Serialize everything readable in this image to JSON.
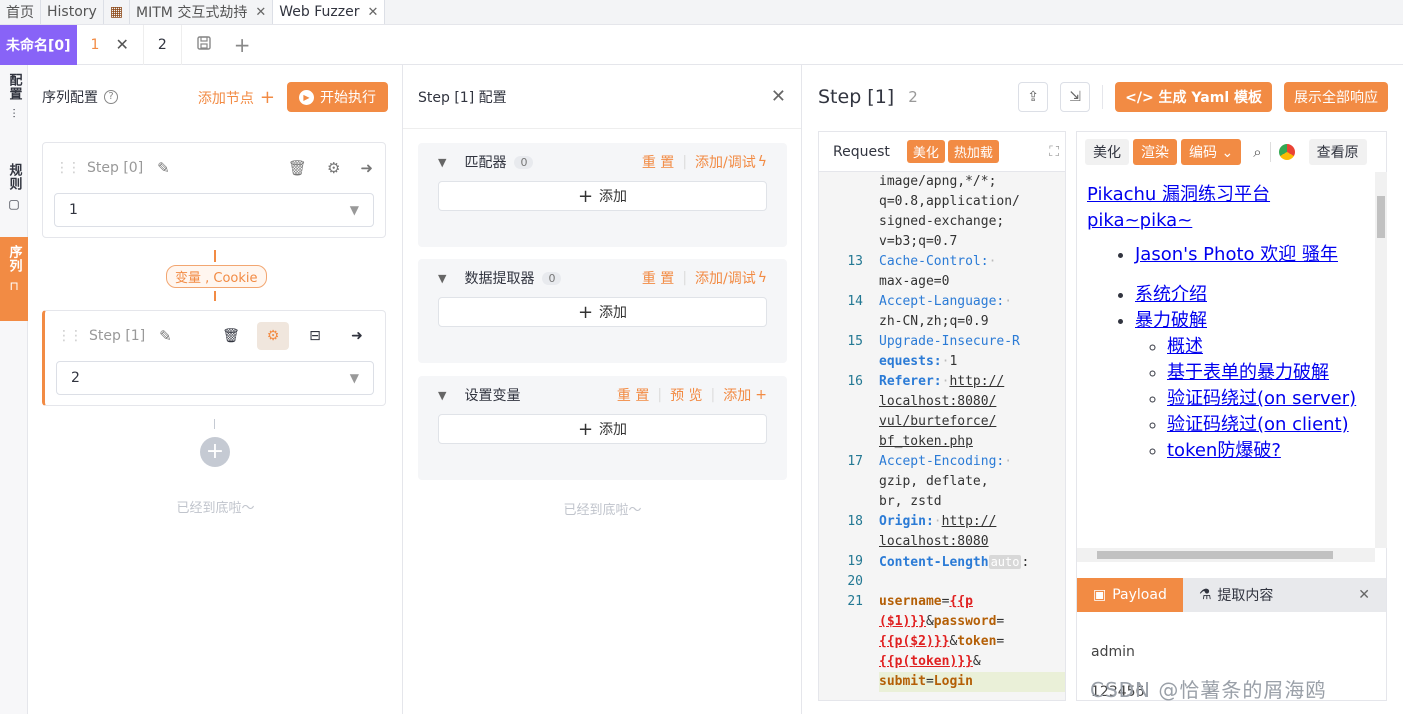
{
  "top_tabs": [
    {
      "label": "首页"
    },
    {
      "label": "History"
    },
    {
      "label": "MITM 交互式劫持",
      "close": "✕"
    },
    {
      "label": "Web Fuzzer",
      "close": "✕"
    }
  ],
  "sub_tabs": {
    "group": "未命名[0]",
    "tab1": "1",
    "tab1_close": "✕",
    "tab2": "2",
    "save_icon": "save-icon",
    "add_icon": "+"
  },
  "vertical_bar": {
    "config": "配置",
    "rules": "规则",
    "sequence": "序列"
  },
  "sequence": {
    "title": "序列配置",
    "help": "?",
    "add_node": "添加节点",
    "run": "开始执行",
    "steps": [
      {
        "name": "Step [0]",
        "value": "1"
      },
      {
        "name": "Step [1]",
        "value": "2"
      }
    ],
    "var_tag": "变量 , Cookie",
    "add_step": "+",
    "bottom_tip": "已经到底啦～"
  },
  "step_config": {
    "title": "Step [1] 配置",
    "close": "✕",
    "sections": [
      {
        "name": "匹配器",
        "count": "0",
        "act1": "重 置",
        "act2": "添加/调试",
        "add": "添加"
      },
      {
        "name": "数据提取器",
        "count": "0",
        "act1": "重 置",
        "act2": "添加/调试",
        "add": "添加"
      },
      {
        "name": "设置变量",
        "act1": "重 置",
        "act2": "预 览",
        "act3": "添加",
        "add": "添加"
      }
    ],
    "bottom_tip": "已经到底啦～"
  },
  "response": {
    "title": "Step [1]",
    "num": "2",
    "yaml_btn": "</> 生成 Yaml 模板",
    "show_all_btn": "展示全部响应",
    "request_label": "Request",
    "beautify": "美化",
    "hot_reload": "热加载",
    "code_lines": [
      {
        "n": "",
        "t": "image/apng,*/*;"
      },
      {
        "n": "",
        "t": "q=0.8,application/"
      },
      {
        "n": "",
        "t": "signed-exchange;"
      },
      {
        "n": "",
        "t": "v=b3;q=0.7"
      },
      {
        "n": "13",
        "k": "Cache-Control:",
        "t": "max-age=0"
      },
      {
        "n": "14",
        "k": "Accept-Language:",
        "t": "zh-CN,zh;q=0.9"
      },
      {
        "n": "15",
        "k": "Upgrade-Insecure-R",
        "k2": "equests:",
        "t": "1"
      },
      {
        "n": "16",
        "k": "Referer:",
        "u1": "http://",
        "u2": "localhost:8080/",
        "u3": "vul/burteforce/",
        "u4": "bf_token.php"
      },
      {
        "n": "17",
        "k": "Accept-Encoding:",
        "t1": "gzip, deflate,",
        "t2": "br, zstd"
      },
      {
        "n": "18",
        "k": "Origin:",
        "u1": "http://",
        "u2": "localhost:8080"
      },
      {
        "n": "19",
        "k": "Content-Length",
        "auto": "auto",
        "colon": ":"
      },
      {
        "n": "20"
      },
      {
        "n": "21"
      }
    ],
    "body": {
      "username": "username",
      "eq": "=",
      "p1a": "{{p",
      "p1b": "($1)}}",
      "amp": "&",
      "password": "password",
      "p2": "{{p($2)}}",
      "token": "token",
      "p3": "{{p(token)}}",
      "submit": "submit",
      "login": "Login"
    },
    "right_toolbar": {
      "beautify": "美化",
      "render": "渲染",
      "encode": "编码 ⌄",
      "view": "查看原"
    },
    "preview": {
      "title_link": "Pikachu 漏洞练习平台 pika~pika~",
      "items": [
        "Jason's Photo 欢迎 骚年",
        "系统介绍",
        "暴力破解"
      ],
      "sub_items": [
        "概述",
        "基于表单的暴力破解",
        "验证码绕过(on server)",
        "验证码绕过(on client)",
        "token防爆破?"
      ]
    },
    "bottom_tabs": {
      "payload": "Payload",
      "extract": "提取内容",
      "close": "✕"
    },
    "payload_values": [
      "admin",
      "123456"
    ]
  },
  "watermark": "CSDN @恰薯条的屑海鸥"
}
